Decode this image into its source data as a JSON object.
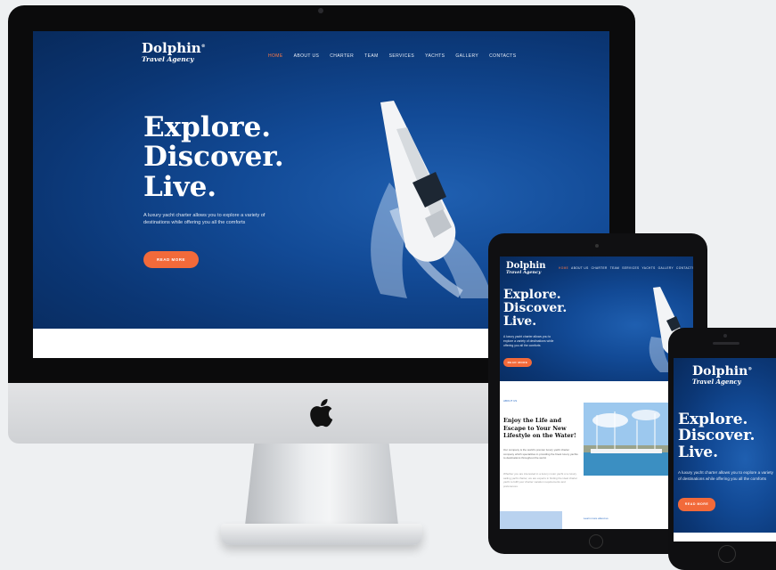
{
  "site": {
    "logo_main": "Dolphin",
    "logo_sub": "Travel Agency",
    "logo_mark": "®",
    "nav": [
      "HOME",
      "ABOUT US",
      "CHARTER",
      "TEAM",
      "SERVICES",
      "YACHTS",
      "GALLERY",
      "CONTACTS"
    ],
    "headline": [
      "Explore.",
      "Discover.",
      "Live."
    ],
    "lead": "A luxury yacht charter allows you to explore a variety of destinations while offering you all the comforts",
    "cta": "READ MORE",
    "section_tag": "ABOUT US",
    "section_title": "Enjoy the Life and Escape to Your New Lifestyle on the Water!",
    "section_p1": "Our company is the world's premier luxury yacht charter company which specializes in providing the finest luxury yachts to destinations throughout the world.",
    "section_p2": "Whether you are interested in a luxury motor yacht or a luxury sailing yacht charter, we are experts in finding the ideal charter yacht to fulfil your charter vacation requirements and preferences.",
    "footer_link": "Learn more about us"
  },
  "colors": {
    "ocean_dark": "#082a5c",
    "ocean_mid": "#124a96",
    "accent": "#f26a3a",
    "nav_active": "#ff7a45"
  },
  "icons": [
    "apple-logo-icon",
    "boat-icon",
    "dolphin-logo-mark-icon"
  ]
}
